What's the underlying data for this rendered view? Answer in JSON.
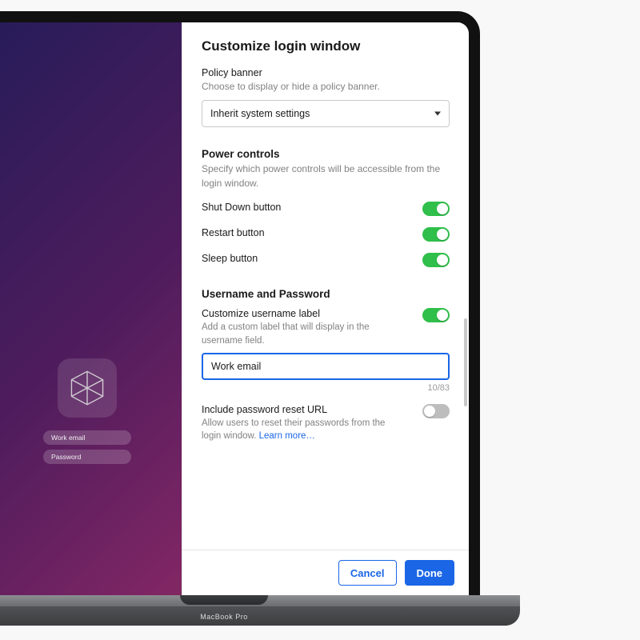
{
  "panel_title": "Customize login window",
  "policy": {
    "label": "Policy banner",
    "desc": "Choose to display or hide a policy banner.",
    "selected": "Inherit system settings"
  },
  "power": {
    "title": "Power controls",
    "desc": "Specify which power controls will be accessible from the login window.",
    "items": [
      {
        "label": "Shut Down button",
        "on": true
      },
      {
        "label": "Restart button",
        "on": true
      },
      {
        "label": "Sleep button",
        "on": true
      }
    ]
  },
  "userpass": {
    "title": "Username and Password",
    "custom_label_toggle": {
      "label": "Customize username label",
      "desc": "Add a custom label that will display in the username field.",
      "on": true
    },
    "custom_label_value": "Work email",
    "char_count": "10/83",
    "reset_url": {
      "label": "Include password reset URL",
      "desc": "Allow users to reset their passwords from the login window. ",
      "learn_more": "Learn more…",
      "on": false
    }
  },
  "footer": {
    "cancel": "Cancel",
    "done": "Done"
  },
  "preview": {
    "username_placeholder": "Work email",
    "password_placeholder": "Password"
  },
  "device_brand": "MacBook Pro"
}
